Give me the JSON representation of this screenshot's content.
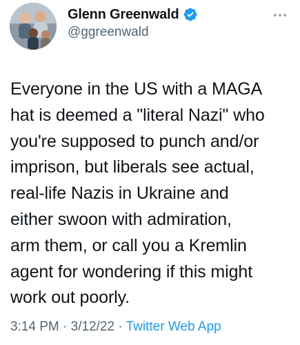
{
  "author": {
    "display_name": "Glenn Greenwald",
    "handle": "@ggreenwald",
    "verified": true
  },
  "icons": {
    "verified": "verified-badge-icon",
    "more": "more-options-icon",
    "avatar": "profile-photo"
  },
  "tweet": {
    "text": "Everyone in the US with a MAGA\nhat is deemed a \"literal Nazi\" who\nyou're supposed to punch and/or\nimprison, but liberals see actual,\nreal-life Nazis in Ukraine and\neither swoon with admiration,\narm them, or call you a Kremlin\nagent for wondering if this might\nwork out poorly."
  },
  "meta": {
    "time": "3:14 PM",
    "separator": " · ",
    "date": "3/12/22",
    "source": "Twitter Web App"
  },
  "colors": {
    "text": "#0f1419",
    "secondary": "#536471",
    "accent": "#1d9bf0"
  }
}
